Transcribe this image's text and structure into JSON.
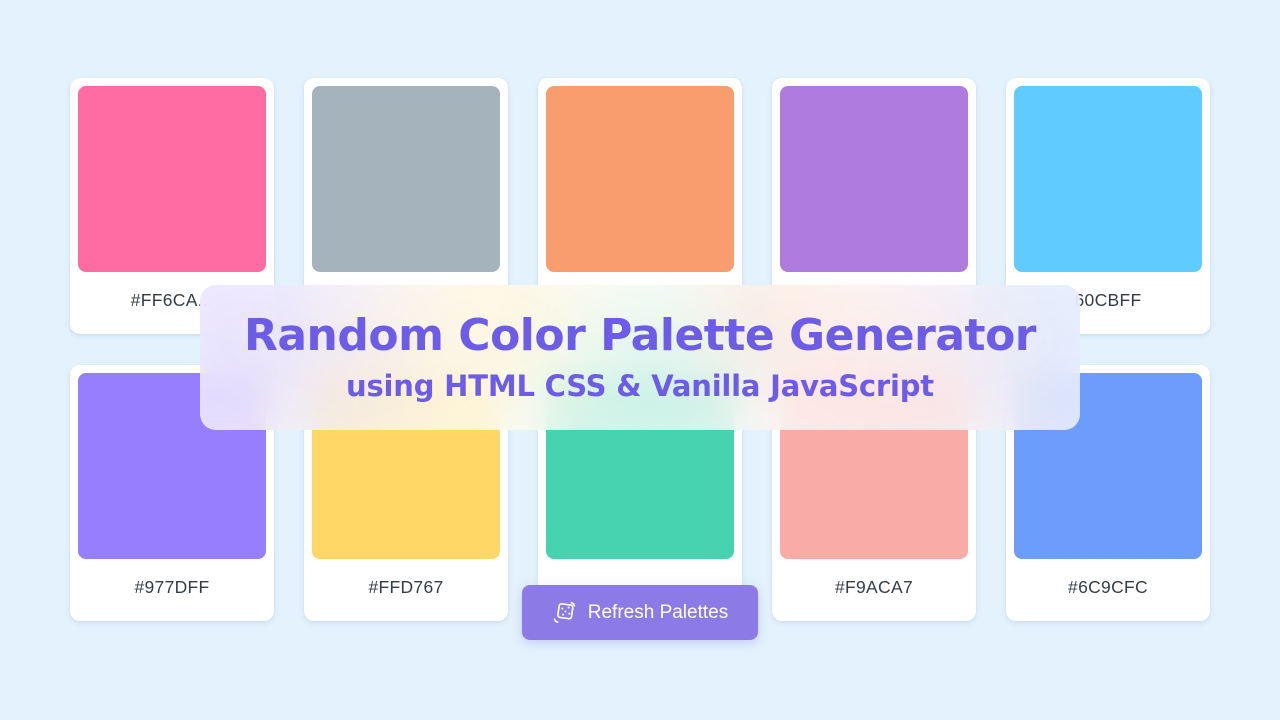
{
  "page": {
    "background_color": "#E3F2FD",
    "title": "Random Color Palette Generator",
    "subtitle": "using HTML CSS & Vanilla JavaScript",
    "title_color": "#6C5CE7"
  },
  "refresh_button": {
    "label": "Refresh Palettes",
    "icon": "dice-roll-icon",
    "background_color": "#8C7AE6",
    "text_color": "#FFFFFF"
  },
  "palettes": [
    {
      "hex_label": "#FF6CA...",
      "color": "#FF6CA4"
    },
    {
      "hex_label": "",
      "color": "#A4B3BC"
    },
    {
      "hex_label": "",
      "color": "#F79D6E"
    },
    {
      "hex_label": "",
      "color": "#AF7BDE"
    },
    {
      "hex_label": "60CBFF",
      "color": "#60CBFF"
    },
    {
      "hex_label": "#977DFF",
      "color": "#977DFF"
    },
    {
      "hex_label": "#FFD767",
      "color": "#FFD767"
    },
    {
      "hex_label": "",
      "color": "#47D2B0"
    },
    {
      "hex_label": "#F9ACA7",
      "color": "#F9ACA7"
    },
    {
      "hex_label": "#6C9CFC",
      "color": "#6C9CFC"
    }
  ]
}
